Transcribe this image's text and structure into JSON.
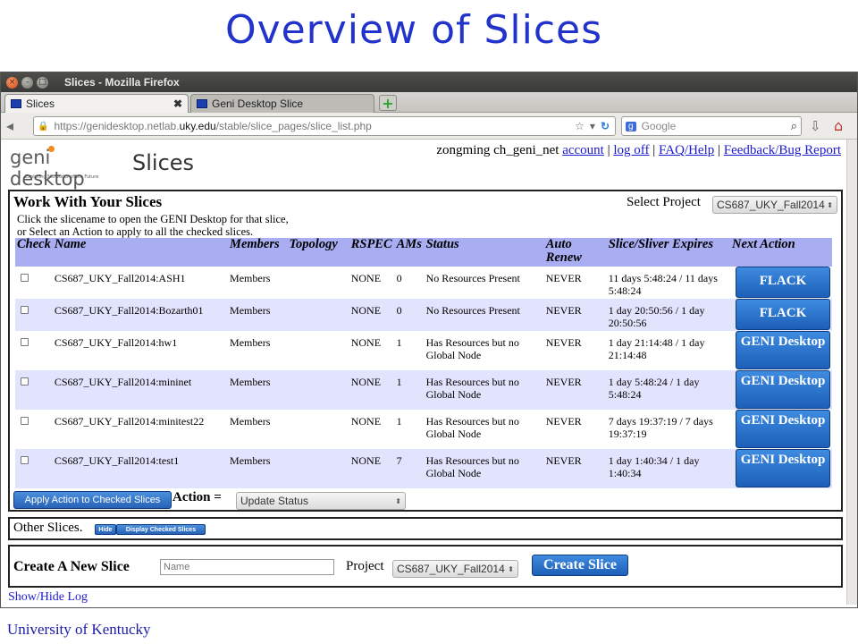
{
  "slide": {
    "title": "Overview of Slices",
    "footer": "University of Kentucky"
  },
  "window": {
    "title": "Slices - Mozilla Firefox",
    "tabs": [
      {
        "label": "Slices",
        "close": "✖"
      },
      {
        "label": "Geni Desktop Slice"
      }
    ],
    "url_prefix": "https://genidesktop.netlab.",
    "url_host": "uky.edu",
    "url_suffix": "/stable/slice_pages/slice_list.php",
    "search_engine": "g",
    "search_placeholder": "Google"
  },
  "page": {
    "logo_geni": "geni",
    "logo_desktop": "desktop",
    "logo_tagline": "Exploring Networks of the Future",
    "heading": "Slices",
    "user": "zongming ch_geni_net",
    "nav_links": [
      "account",
      "log off",
      "FAQ/Help",
      "Feedback/Bug Report"
    ],
    "work": {
      "title": "Work With Your Slices",
      "help_line1": "Click the slicename to open the GENI Desktop for that slice,",
      "help_line2": "or Select an Action to apply to all the checked slices.",
      "select_project_label": "Select Project",
      "selected_project": "CS687_UKY_Fall2014",
      "columns": [
        "Check",
        "Name",
        "Members",
        "Topology",
        "RSPEC",
        "AMs",
        "Status",
        "Auto Renew",
        "Slice/Sliver Expires",
        "Next Action"
      ],
      "rows": [
        {
          "name": "CS687_UKY_Fall2014:ASH1",
          "members": "Members",
          "rspec": "NONE",
          "ams": "0",
          "status": "No Resources Present",
          "renew": "NEVER",
          "expires": "11 days 5:48:24 / 11 days 5:48:24",
          "action": "FLACK"
        },
        {
          "name": "CS687_UKY_Fall2014:Bozarth01",
          "members": "Members",
          "rspec": "NONE",
          "ams": "0",
          "status": "No Resources Present",
          "renew": "NEVER",
          "expires": "1 day 20:50:56 / 1 day 20:50:56",
          "action": "FLACK"
        },
        {
          "name": "CS687_UKY_Fall2014:hw1",
          "members": "Members",
          "rspec": "NONE",
          "ams": "1",
          "status": "Has Resources but no Global Node",
          "renew": "NEVER",
          "expires": "1 day 21:14:48 / 1 day 21:14:48",
          "action": "GENI Desktop"
        },
        {
          "name": "CS687_UKY_Fall2014:mininet",
          "members": "Members",
          "rspec": "NONE",
          "ams": "1",
          "status": "Has Resources but no Global Node",
          "renew": "NEVER",
          "expires": "1 day 5:48:24 / 1 day 5:48:24",
          "action": "GENI Desktop"
        },
        {
          "name": "CS687_UKY_Fall2014:minitest22",
          "members": "Members",
          "rspec": "NONE",
          "ams": "1",
          "status": "Has Resources but no Global Node",
          "renew": "NEVER",
          "expires": "7 days 19:37:19 / 7 days 19:37:19",
          "action": "GENI Desktop"
        },
        {
          "name": "CS687_UKY_Fall2014:test1",
          "members": "Members",
          "rspec": "NONE",
          "ams": "7",
          "status": "Has Resources but no Global Node",
          "renew": "NEVER",
          "expires": "1 day 1:40:34 / 1 day 1:40:34",
          "action": "GENI Desktop"
        }
      ],
      "apply_button": "Apply Action to Checked Slices",
      "action_label": "Action =",
      "action_value": "Update Status"
    },
    "other": {
      "label": "Other Slices.",
      "hide_button": "Hide",
      "display_button": "Display Checked Slices"
    },
    "create": {
      "label": "Create A New Slice",
      "name_placeholder": "Name",
      "project_label": "Project",
      "project_value": "CS687_UKY_Fall2014",
      "button": "Create Slice"
    },
    "show_hide_log": "Show/Hide Log"
  }
}
